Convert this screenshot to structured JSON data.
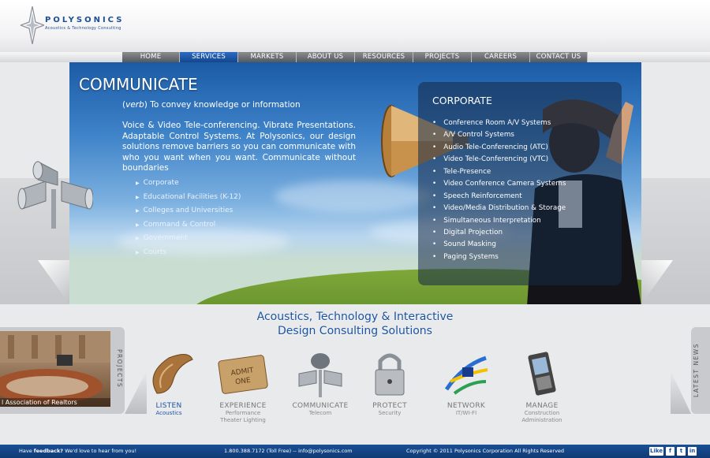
{
  "brand": {
    "name": "POLYSONICS",
    "tagline": "Acoustics & Technology Consulting"
  },
  "nav": {
    "items": [
      {
        "label": "HOME",
        "active": false
      },
      {
        "label": "SERVICES",
        "active": true
      },
      {
        "label": "MARKETS",
        "active": false
      },
      {
        "label": "ABOUT US",
        "active": false
      },
      {
        "label": "RESOURCES",
        "active": false
      },
      {
        "label": "PROJECTS",
        "active": false
      },
      {
        "label": "CAREERS",
        "active": false
      },
      {
        "label": "CONTACT US",
        "active": false
      }
    ]
  },
  "hero": {
    "title": "COMMUNICATE",
    "definition_word": "verb",
    "definition_text": "To convey knowledge or information",
    "body": "Voice & Video Tele-conferencing. Vibrate Presentations. Adaptable Control Systems. At Polysonics, our design solutions remove barriers so you can communicate with who you want when you want. Communicate without boundaries",
    "links": [
      "Corporate",
      "Educational Facilities (K-12)",
      "Colleges and Universities",
      "Command & Control",
      "Government",
      "Courts"
    ]
  },
  "panel": {
    "title": "CORPORATE",
    "items": [
      "Conference Room A/V Systems",
      "A/V Control Systems",
      "Audio Tele-Conferencing (ATC)",
      "Video Tele-Conferencing (VTC)",
      "Tele-Presence",
      "Video Conference Camera Systems",
      "Speech Reinforcement",
      "Video/Media Distribution & Storage",
      "Simultaneous Interpretation",
      "Digital Projection",
      "Sound Masking",
      "Paging Systems"
    ]
  },
  "tagline": {
    "line1": "Acoustics, Technology & Interactive",
    "line2": "Design Consulting Solutions"
  },
  "projects": {
    "label": "PROJECTS",
    "caption": "l Association of Realtors"
  },
  "news": {
    "label": "LATEST NEWS"
  },
  "services": [
    {
      "name": "LISTEN",
      "sub1": "Acoustics",
      "sub2": "",
      "icon": "shell-icon",
      "active": true
    },
    {
      "name": "EXPERIENCE",
      "sub1": "Performance",
      "sub2": "Theater Lighting",
      "icon": "ticket-icon",
      "active": false
    },
    {
      "name": "COMMUNICATE",
      "sub1": "Telecom",
      "sub2": "",
      "icon": "speaker-icon",
      "active": false
    },
    {
      "name": "PROTECT",
      "sub1": "Security",
      "sub2": "",
      "icon": "padlock-icon",
      "active": false
    },
    {
      "name": "NETWORK",
      "sub1": "IT/WI-FI",
      "sub2": "",
      "icon": "network-cables-icon",
      "active": false
    },
    {
      "name": "MANAGE",
      "sub1": "Construction",
      "sub2": "Administration",
      "icon": "phone-icon",
      "active": false
    }
  ],
  "footer": {
    "feedback_prefix": "Have",
    "feedback_link": "feedback?",
    "feedback_suffix": "We'd love to hear from you!",
    "contact": "1.800.388.7172 (Toll Free)  --  info@polysonics.com",
    "copyright": "Copyright  ©  2011 Polysonics Corporation   All Rights Reserved",
    "social": [
      "Like",
      "f",
      "t",
      "in"
    ]
  },
  "colors": {
    "brand_blue": "#1c53a0",
    "nav_active": "#1d5bb0",
    "footer_blue": "#15468c"
  }
}
